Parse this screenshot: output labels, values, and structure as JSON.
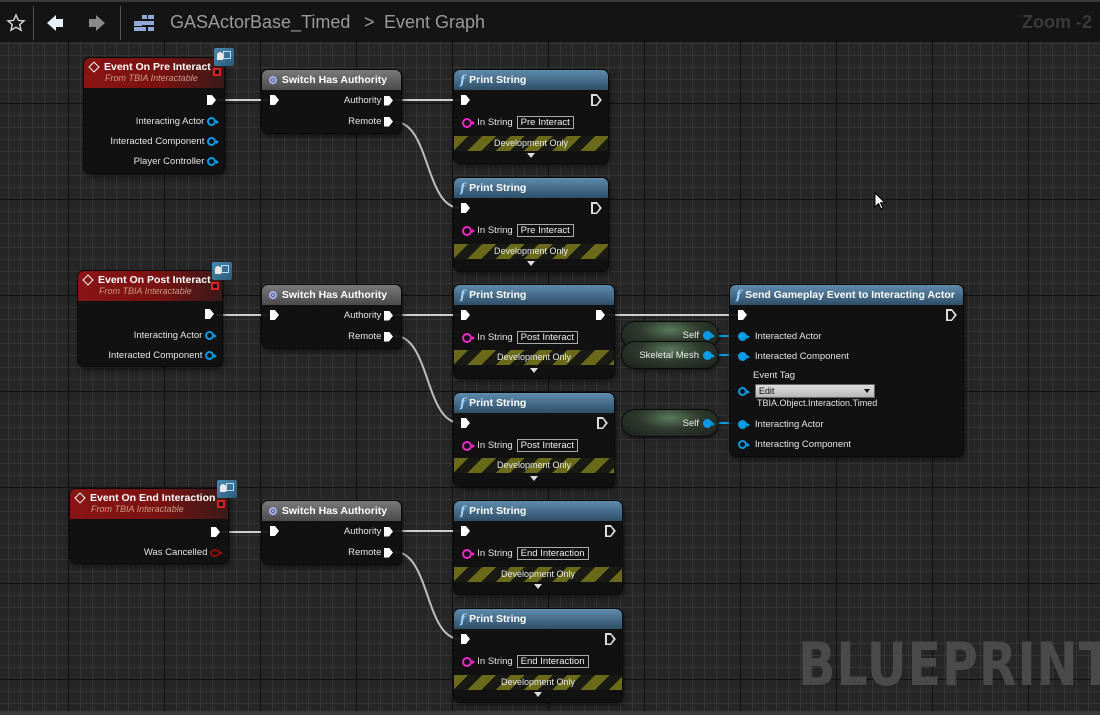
{
  "toolbar": {
    "favorite_icon": "star-icon",
    "back_icon": "arrow-left-icon",
    "forward_icon": "arrow-right-icon",
    "blueprint_icon": "blueprint-graph-icon",
    "breadcrumb_root": "GASActorBase_Timed",
    "breadcrumb_separator": ">",
    "breadcrumb_leaf": "Event Graph",
    "zoom_label": "Zoom -2"
  },
  "watermark": "BLUEPRINT",
  "colors": {
    "event_header": "#8a1414",
    "function_header": "#3a6080",
    "switch_header": "#5a5a5a",
    "object_pin": "#0a9be6",
    "string_pin": "#f026c8",
    "bool_pin": "#8a0e0e",
    "dev_only_stripe": "#6a6a1a"
  },
  "events": [
    {
      "title": "Event On Pre Interact",
      "subtitle": "From TBIA Interactable",
      "outputs": [
        "Interacting Actor",
        "Interacted Component",
        "Player Controller"
      ]
    },
    {
      "title": "Event On Post Interact",
      "subtitle": "From TBIA Interactable",
      "outputs": [
        "Interacting Actor",
        "Interacted Component"
      ]
    },
    {
      "title": "Event On End Interaction",
      "subtitle": "From TBIA Interactable",
      "outputs": [
        "Was Cancelled"
      ]
    }
  ],
  "switch_node": {
    "title": "Switch Has Authority",
    "authority_label": "Authority",
    "remote_label": "Remote"
  },
  "print_nodes": [
    {
      "title": "Print String",
      "in_label": "In String",
      "value": "Pre Interact",
      "footer": "Development Only"
    },
    {
      "title": "Print String",
      "in_label": "In String",
      "value": "Pre Interact",
      "footer": "Development Only"
    },
    {
      "title": "Print String",
      "in_label": "In String",
      "value": "Post Interact",
      "footer": "Development Only"
    },
    {
      "title": "Print String",
      "in_label": "In String",
      "value": "Post Interact",
      "footer": "Development Only"
    },
    {
      "title": "Print String",
      "in_label": "In String",
      "value": "End Interaction",
      "footer": "Development Only"
    },
    {
      "title": "Print String",
      "in_label": "In String",
      "value": "End Interaction",
      "footer": "Development Only"
    }
  ],
  "send_event_node": {
    "title": "Send Gameplay Event to Interacting Actor",
    "pins": {
      "interacted_actor": "Interacted Actor",
      "interacted_component": "Interacted Component",
      "event_tag": "Event Tag",
      "event_tag_dropdown": "Edit",
      "event_tag_value": "TBIA.Object.Interaction.Timed",
      "interacting_actor": "Interacting Actor",
      "interacting_component": "Interacting Component"
    }
  },
  "variables": [
    {
      "label": "Self"
    },
    {
      "label": "Skeletal Mesh"
    },
    {
      "label": "Self"
    }
  ]
}
